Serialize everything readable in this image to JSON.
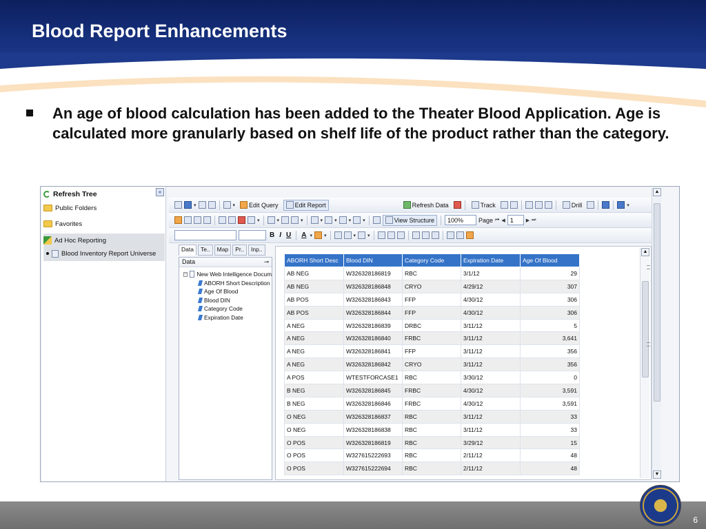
{
  "slide": {
    "title": "Blood Report Enhancements",
    "bullet": "An age of blood calculation has been added to the Theater Blood Application.  Age is calculated more granularly based on shelf life of the product rather than the category.",
    "page_number": "6"
  },
  "colors": {
    "title_band": "#16307c",
    "table_header": "#3573c8",
    "footer": "#7a7a7a"
  },
  "nav": {
    "refresh_tree": "Refresh Tree",
    "collapse_label": "«",
    "items": [
      {
        "label": "Public Folders",
        "icon": "folder-icon"
      },
      {
        "label": "Favorites",
        "icon": "folder-icon"
      },
      {
        "label": "Ad Hoc Reporting",
        "icon": "ad-hoc-icon"
      },
      {
        "label": "Blood Inventory Report Universe",
        "icon": "report-icon"
      }
    ]
  },
  "toolbar": {
    "edit_query": "Edit Query",
    "edit_report": "Edit Report",
    "refresh_data": "Refresh Data",
    "track": "Track",
    "drill": "Drill",
    "view_structure": "View Structure",
    "zoom": "100%",
    "page_label": "Page",
    "page_value": "1",
    "bold": "B",
    "italic": "I",
    "underline": "U",
    "font_color": "A"
  },
  "side_tabs": [
    "Data",
    "Te..",
    "Map",
    "Pr..",
    "Inp.."
  ],
  "data_panel": {
    "header": "Data",
    "pin": "ᵖ",
    "root": "New Web Intelligence Docum",
    "objects": [
      "ABORH Short Description",
      "Age Of Blood",
      "Blood DIN",
      "Category Code",
      "Expiration Date"
    ]
  },
  "report": {
    "columns": [
      "ABORH Short Desc",
      "Blood DIN",
      "Category Code",
      "Expiration Date",
      "Age Of Blood"
    ],
    "rows": [
      [
        "AB NEG",
        "W326328186819",
        "RBC",
        "3/1/12",
        "29"
      ],
      [
        "AB NEG",
        "W326328186848",
        "CRYO",
        "4/29/12",
        "307"
      ],
      [
        "AB POS",
        "W326328186843",
        "FFP",
        "4/30/12",
        "306"
      ],
      [
        "AB POS",
        "W326328186844",
        "FFP",
        "4/30/12",
        "306"
      ],
      [
        "A NEG",
        "W326328186839",
        "DRBC",
        "3/11/12",
        "5"
      ],
      [
        "A NEG",
        "W326328186840",
        "FRBC",
        "3/11/12",
        "3,641"
      ],
      [
        "A NEG",
        "W326328186841",
        "FFP",
        "3/11/12",
        "356"
      ],
      [
        "A NEG",
        "W326328186842",
        "CRYO",
        "3/11/12",
        "356"
      ],
      [
        "A POS",
        "WTESTFORCASE1",
        "RBC",
        "3/30/12",
        "0"
      ],
      [
        "B NEG",
        "W326328186845",
        "FRBC",
        "4/30/12",
        "3,591"
      ],
      [
        "B NEG",
        "W326328186846",
        "FRBC",
        "4/30/12",
        "3,591"
      ],
      [
        "O NEG",
        "W326328186837",
        "RBC",
        "3/11/12",
        "33"
      ],
      [
        "O NEG",
        "W326328186838",
        "RBC",
        "3/11/12",
        "33"
      ],
      [
        "O POS",
        "W326328186819",
        "RBC",
        "3/29/12",
        "15"
      ],
      [
        "O POS",
        "W327615222693",
        "RBC",
        "2/11/12",
        "48"
      ],
      [
        "O POS",
        "W327615222694",
        "RBC",
        "2/11/12",
        "48"
      ]
    ]
  }
}
